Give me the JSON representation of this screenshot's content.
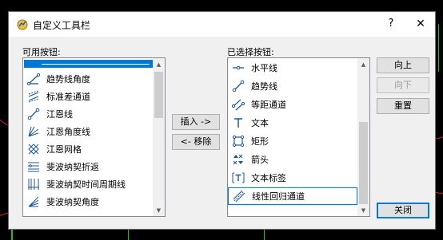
{
  "window": {
    "title": "自定义工具栏",
    "help_label": "?",
    "close_label": "✕"
  },
  "available": {
    "label": "可用按钮:",
    "items": [
      {
        "label": "",
        "icon": "separator-line-icon"
      },
      {
        "label": "趋势线角度",
        "icon": "trendline-angle-icon"
      },
      {
        "label": "标准差通道",
        "icon": "stddev-channel-icon"
      },
      {
        "label": "江恩线",
        "icon": "gann-line-icon"
      },
      {
        "label": "江恩角度线",
        "icon": "gann-fan-icon"
      },
      {
        "label": "江恩网格",
        "icon": "gann-grid-icon"
      },
      {
        "label": "斐波纳契折返",
        "icon": "fibo-retracement-icon"
      },
      {
        "label": "斐波纳契时间周期线",
        "icon": "fibo-timezones-icon"
      },
      {
        "label": "斐波纳契角度",
        "icon": "fibo-fan-icon"
      }
    ]
  },
  "middle_buttons": {
    "insert": "插入 ->",
    "remove": "<- 移除"
  },
  "selected": {
    "label": "已选择按钮:",
    "items": [
      {
        "label": "水平线",
        "icon": "horizontal-line-icon"
      },
      {
        "label": "趋势线",
        "icon": "trendline-icon"
      },
      {
        "label": "等距通道",
        "icon": "equidistant-channel-icon"
      },
      {
        "label": "文本",
        "icon": "text-icon"
      },
      {
        "label": "矩形",
        "icon": "rectangle-icon"
      },
      {
        "label": "箭头",
        "icon": "arrows-icon"
      },
      {
        "label": "文本标签",
        "icon": "text-label-icon"
      },
      {
        "label": "线性回归通道",
        "icon": "regression-channel-icon"
      }
    ]
  },
  "right_buttons": {
    "up": "向上",
    "down": "向下",
    "reset": "重置",
    "close": "关闭"
  },
  "colors": {
    "accent": "#0078d7",
    "icon": "#1e5799",
    "bg_red": "#d02020",
    "bg_green": "#20c020"
  }
}
